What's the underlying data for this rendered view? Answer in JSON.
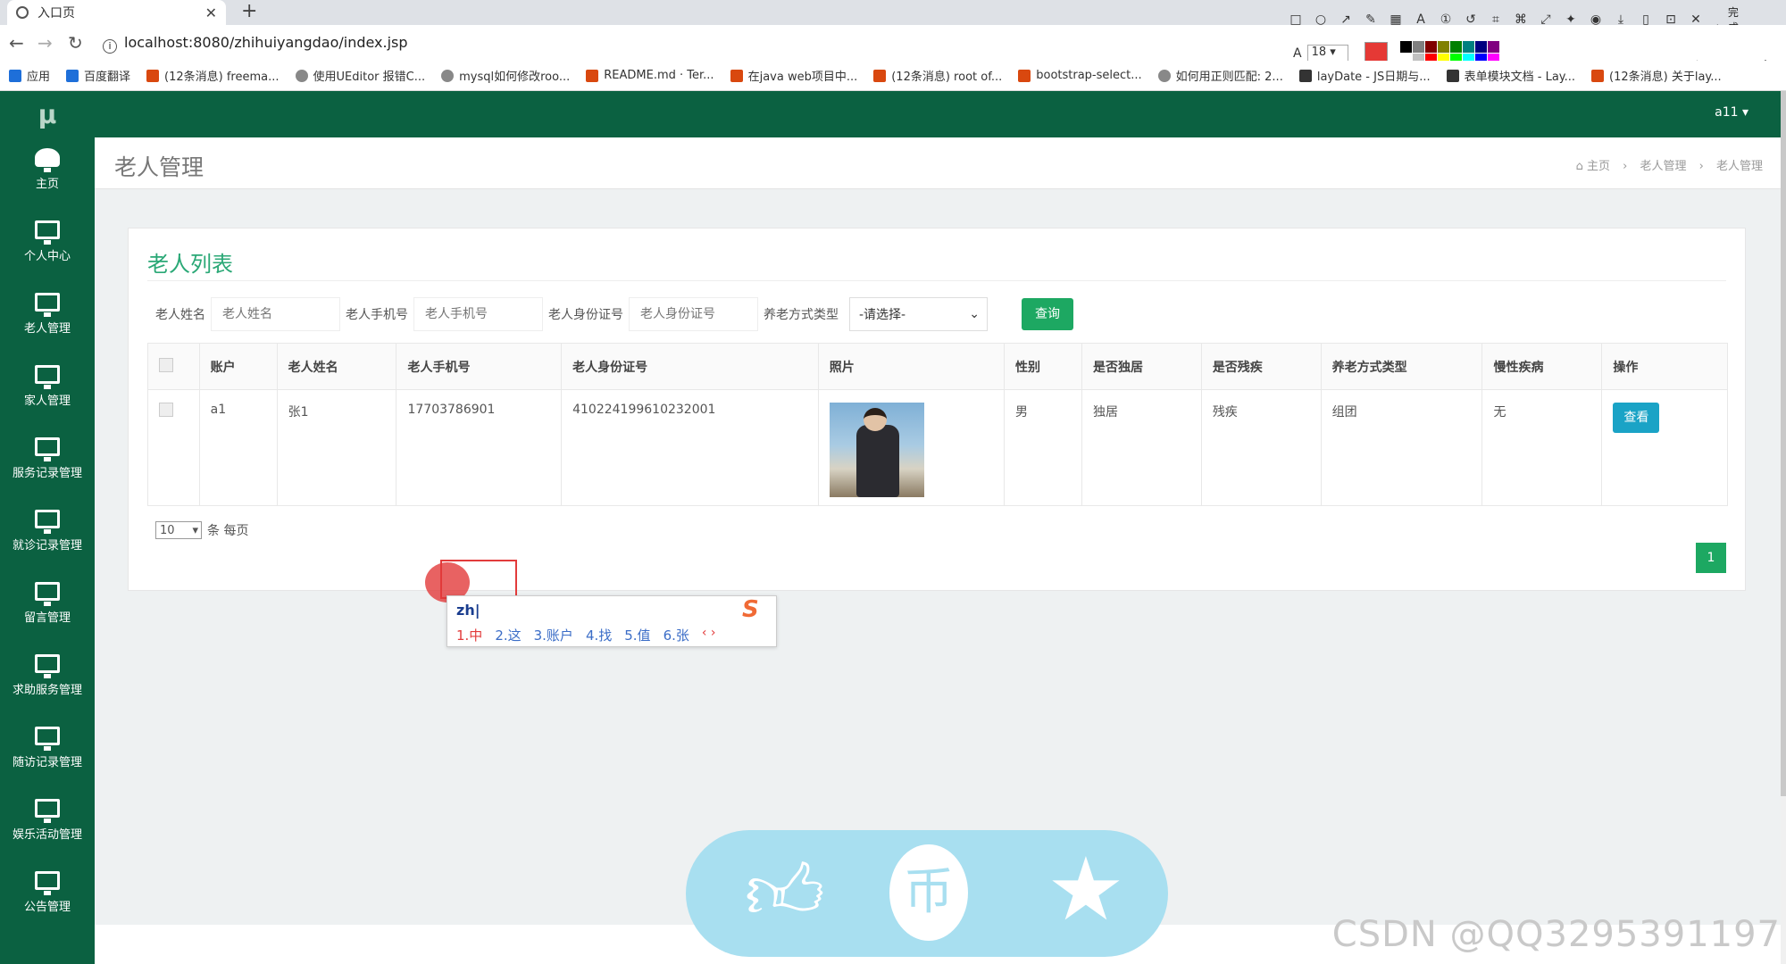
{
  "browser": {
    "tab_title": "入口页",
    "new_tab": "+",
    "url": "localhost:8080/zhihuiyangdao/index.jsp",
    "bookmarks": [
      {
        "label": "应用",
        "icon": "apps-icon"
      },
      {
        "label": "百度翻译",
        "icon": "baidu-translate-icon"
      },
      {
        "label": "(12条消息) freema...",
        "icon": "csdn-icon"
      },
      {
        "label": "使用UEditor 报错C...",
        "icon": "link-icon"
      },
      {
        "label": "mysql如何修改roo...",
        "icon": "link-icon"
      },
      {
        "label": "README.md · Ter...",
        "icon": "gitee-icon"
      },
      {
        "label": "在java web项目中...",
        "icon": "csdn-icon"
      },
      {
        "label": "(12条消息) root of...",
        "icon": "csdn-icon"
      },
      {
        "label": "bootstrap-select...",
        "icon": "bookmark-icon"
      },
      {
        "label": "如何用正则匹配: 2...",
        "icon": "baidu-icon"
      },
      {
        "label": "layDate - JS日期与...",
        "icon": "layui-icon"
      },
      {
        "label": "表单模块文档 - Lay...",
        "icon": "layui-icon"
      },
      {
        "label": "(12条消息) 关于lay...",
        "icon": "csdn-icon"
      }
    ],
    "snip_font_size": "18",
    "snip_done": "完成",
    "palette": [
      "#000000",
      "#808080",
      "#800000",
      "#808000",
      "#008000",
      "#008080",
      "#000080",
      "#800080",
      "#ffffff",
      "#c0c0c0",
      "#ff0000",
      "#ffff00",
      "#00ff00",
      "#00ffff",
      "#0000ff",
      "#ff00ff"
    ]
  },
  "sidebar": {
    "logo": "μ",
    "items": [
      {
        "label": "主页",
        "icon": "dashboard-icon"
      },
      {
        "label": "个人中心",
        "icon": "monitor-icon"
      },
      {
        "label": "老人管理",
        "icon": "monitor-icon"
      },
      {
        "label": "家人管理",
        "icon": "monitor-icon"
      },
      {
        "label": "服务记录管理",
        "icon": "monitor-icon"
      },
      {
        "label": "就诊记录管理",
        "icon": "monitor-icon"
      },
      {
        "label": "留言管理",
        "icon": "monitor-icon"
      },
      {
        "label": "求助服务管理",
        "icon": "monitor-icon"
      },
      {
        "label": "随访记录管理",
        "icon": "monitor-icon"
      },
      {
        "label": "娱乐活动管理",
        "icon": "monitor-icon"
      },
      {
        "label": "公告管理",
        "icon": "monitor-icon"
      }
    ]
  },
  "topbar": {
    "user": "a11 ▾"
  },
  "page": {
    "title": "老人管理",
    "breadcrumb": [
      "主页",
      "老人管理",
      "老人管理"
    ]
  },
  "card": {
    "title": "老人列表",
    "filters": {
      "name_label": "老人姓名",
      "name_placeholder": "老人姓名",
      "phone_label": "老人手机号",
      "phone_placeholder": "老人手机号",
      "id_label": "老人身份证号",
      "id_placeholder": "老人身份证号",
      "type_label": "养老方式类型",
      "type_value": "-请选择-",
      "query_button": "查询"
    },
    "table": {
      "headers": [
        "账户",
        "老人姓名",
        "老人手机号",
        "老人身份证号",
        "照片",
        "性别",
        "是否独居",
        "是否残疾",
        "养老方式类型",
        "慢性疾病",
        "操作"
      ],
      "rows": [
        {
          "account": "a1",
          "name": "张1",
          "phone": "17703786901",
          "id_card": "410224199610232001",
          "gender": "男",
          "lives_alone": "独居",
          "disabled": "残疾",
          "care_type": "组团",
          "chronic": "无",
          "action": "查看"
        }
      ]
    },
    "pager": {
      "page_size": "10",
      "per_page_label": "条 每页",
      "current_page": "1"
    }
  },
  "ime": {
    "input": "zh",
    "candidates": [
      "1.中",
      "2.这",
      "3.账户",
      "4.找",
      "5.值",
      "6.张"
    ],
    "logo": "S"
  },
  "watermark": "CSDN @QQ3295391197"
}
